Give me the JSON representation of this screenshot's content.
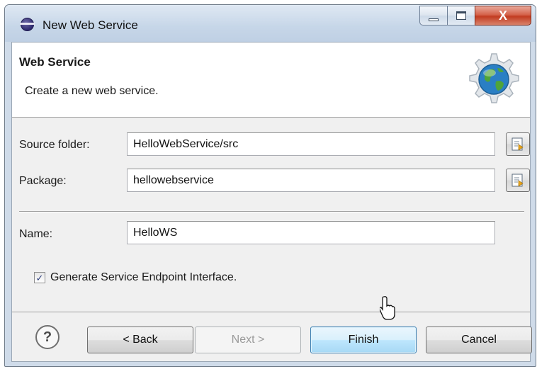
{
  "window": {
    "title": "New Web Service",
    "close_glyph": "X"
  },
  "banner": {
    "heading": "Web Service",
    "description": "Create a new web service.",
    "icon": "web-service-globe-gear-icon"
  },
  "form": {
    "source_folder": {
      "label": "Source folder:",
      "value": "HelloWebService/src"
    },
    "package": {
      "label": "Package:",
      "value": "hellowebservice"
    },
    "name": {
      "label": "Name:",
      "value": "HelloWS"
    },
    "generate_sei": {
      "label": "Generate Service Endpoint Interface.",
      "checked": true,
      "check_glyph": "✓"
    }
  },
  "buttons": {
    "help": "?",
    "back": "< Back",
    "next": "Next >",
    "finish": "Finish",
    "cancel": "Cancel"
  },
  "colors": {
    "accent_default_button": "#3c7fb1",
    "close_button": "#c23c21"
  }
}
